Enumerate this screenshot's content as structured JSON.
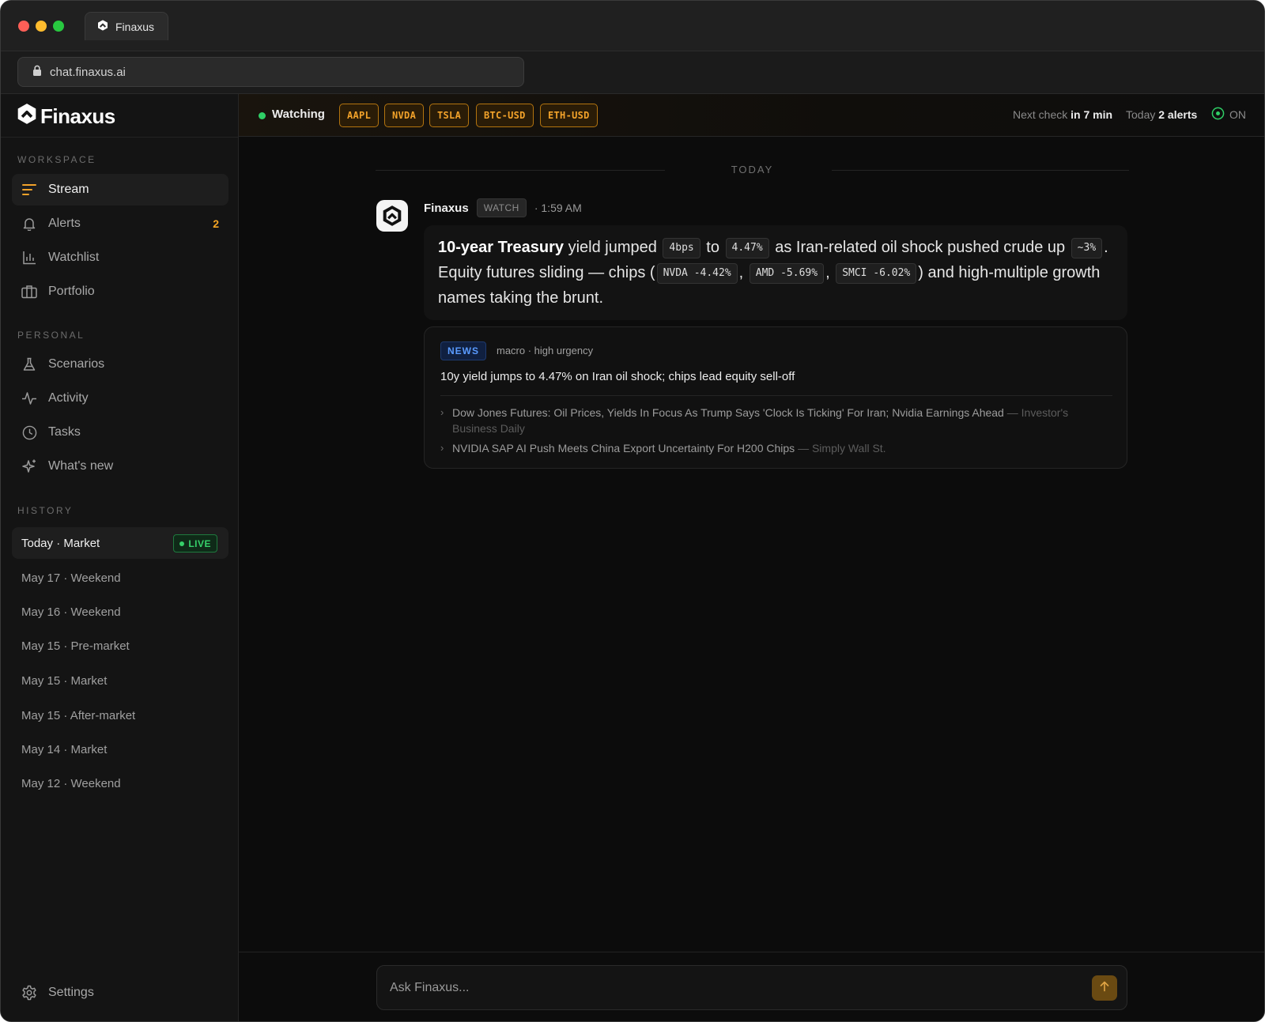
{
  "browser": {
    "tab_title": "Finaxus",
    "url": "chat.finaxus.ai"
  },
  "sidebar": {
    "brand": "Finaxus",
    "workspace_label": "WORKSPACE",
    "workspace_items": [
      {
        "label": "Stream",
        "icon": "stream-icon",
        "active": true
      },
      {
        "label": "Alerts",
        "icon": "bell-icon",
        "badge": "2"
      },
      {
        "label": "Watchlist",
        "icon": "bar-chart-icon"
      },
      {
        "label": "Portfolio",
        "icon": "briefcase-icon"
      }
    ],
    "personal_label": "PERSONAL",
    "personal_items": [
      {
        "label": "Scenarios",
        "icon": "flask-icon"
      },
      {
        "label": "Activity",
        "icon": "activity-icon"
      },
      {
        "label": "Tasks",
        "icon": "clock-icon"
      },
      {
        "label": "What's new",
        "icon": "sparkle-icon"
      }
    ],
    "history_label": "HISTORY",
    "history_items": [
      {
        "label": "Today · Market",
        "active": true,
        "badge": "LIVE"
      },
      {
        "label": "May 17 · Weekend"
      },
      {
        "label": "May 16 · Weekend"
      },
      {
        "label": "May 15 · Pre-market"
      },
      {
        "label": "May 15 · Market"
      },
      {
        "label": "May 15 · After-market"
      },
      {
        "label": "May 14 · Market"
      },
      {
        "label": "May 12 · Weekend"
      }
    ],
    "settings_label": "Settings"
  },
  "watchbar": {
    "label": "Watching",
    "tickers": [
      "AAPL",
      "NVDA",
      "TSLA",
      "BTC-USD",
      "ETH-USD"
    ],
    "next_check_prefix": "Next check",
    "next_check_value": "in 7 min",
    "today_prefix": "Today",
    "today_value": "2 alerts",
    "status": "ON"
  },
  "stream": {
    "day_label": "TODAY",
    "message": {
      "author": "Finaxus",
      "tag": "WATCH",
      "time": "· 1:59 AM",
      "body": {
        "bold": "10-year Treasury",
        "t1": " yield jumped ",
        "c1": "4bps",
        "t2": " to ",
        "c2": "4.47%",
        "t3": " as Iran-related oil shock pushed crude up ",
        "c3": "~3%",
        "t4": ". Equity futures sliding — chips (",
        "c4": "NVDA -4.42%",
        "t5": ", ",
        "c5": "AMD -5.69%",
        "t6": ", ",
        "c6": "SMCI -6.02%",
        "t7": ") and high-multiple growth names taking the brunt."
      }
    },
    "news": {
      "badge": "NEWS",
      "meta": "macro · high urgency",
      "title": "10y yield jumps to 4.47% on Iran oil shock; chips lead equity sell-off",
      "links": [
        {
          "text": "Dow Jones Futures: Oil Prices, Yields In Focus As Trump Says 'Clock Is Ticking' For Iran; Nvidia Earnings Ahead",
          "source": "— Investor's Business Daily"
        },
        {
          "text": "NVIDIA SAP AI Push Meets China Export Uncertainty For H200 Chips",
          "source": "— Simply Wall St."
        }
      ]
    }
  },
  "composer": {
    "placeholder": "Ask Finaxus..."
  },
  "colors": {
    "accent": "#f2a22a",
    "live_green": "#36d06a",
    "news_blue": "#5a9bff",
    "background": "#0c0c0c"
  }
}
